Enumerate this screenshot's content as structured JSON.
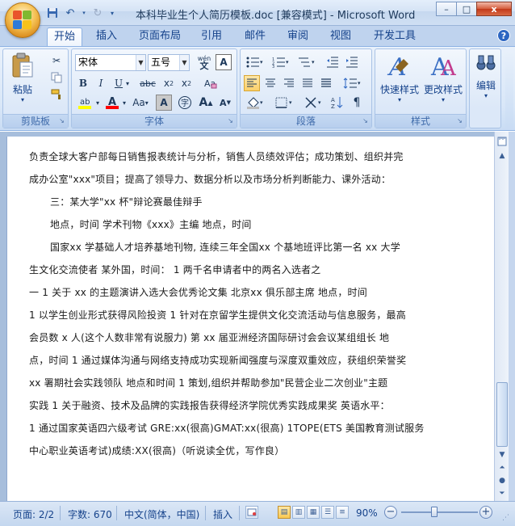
{
  "window": {
    "title": "本科毕业生个人简历模板.doc [兼容模式] - Microsoft Word",
    "controls": {
      "minimize": "–",
      "maximize": "□",
      "close": "x"
    }
  },
  "tabs": [
    "开始",
    "插入",
    "页面布局",
    "引用",
    "邮件",
    "审阅",
    "视图",
    "开发工具"
  ],
  "active_tab": "开始",
  "ribbon": {
    "clipboard": {
      "label": "剪贴板",
      "paste": "粘贴"
    },
    "font": {
      "label": "字体",
      "font_name": "宋体",
      "font_size": "五号",
      "wen": "wén",
      "char_a": "A"
    },
    "paragraph": {
      "label": "段落"
    },
    "styles": {
      "label": "样式",
      "quick_styles": "快速样式",
      "change_styles": "更改样式"
    },
    "editing": {
      "label": "编辑"
    }
  },
  "document": {
    "lines": [
      "负责全球大客户部每日销售报表统计与分析，销售人员绩效评估；成功策划、组织并完",
      "成办公室\"xxx\"项目；提高了领导力、数据分析以及市场分析判断能力、课外活动：",
      "三：某大学\"xx 杯\"辩论赛最佳辩手",
      "地点，时间      学术刊物《xxx》主编                 地点，时间",
      "国家xx 学基础人才培养基地刊物, 连续三年全国xx 个基地班评比第一名          xx 大学",
      "生文化交流使者                              某外国，时间：       1 两千名申请者中的两名入选者之",
      "一       1 关于 xx 的主题演讲入选大会优秀论文集        北京xx 俱乐部主席           地点，时间",
      "1 以学生创业形式获得风险投资        1 针对在京留学生提供文化交流活动与信息服务，最高",
      "会员数 x 人(这个人数非常有说服力)          第 xx 届亚洲经济国际研讨会会议某组组长        地",
      "点，时间        1 通过媒体沟通与网络支持成功实现新闻强度与深度双重效应，获组织荣誉奖",
      "xx 署期社会实践领队         地点和时间        1 策划,组织并帮助参加\"民营企业二次创业\"主题",
      "实践        1 关于融资、技术及品牌的实践报告获得经济学院优秀实践成果奖         英语水平：",
      "1 通过国家英语四六级考试 GRE:xx(很高)GMAT:xx(很高)        1TOPE(ETS 美国教育测试服务",
      "中心职业英语考试)成绩:XX(很高)（听说读全优，写作良）"
    ]
  },
  "status_bar": {
    "page": "页面: 2/2",
    "words": "字数: 670",
    "language": "中文(简体，中国)",
    "mode": "插入",
    "zoom": "90%",
    "zoom_minus": "−",
    "zoom_plus": "+"
  },
  "colors": {
    "accent": "#15428b",
    "highlight_yellow": "#ffff00",
    "font_color_red": "#ff0000"
  }
}
